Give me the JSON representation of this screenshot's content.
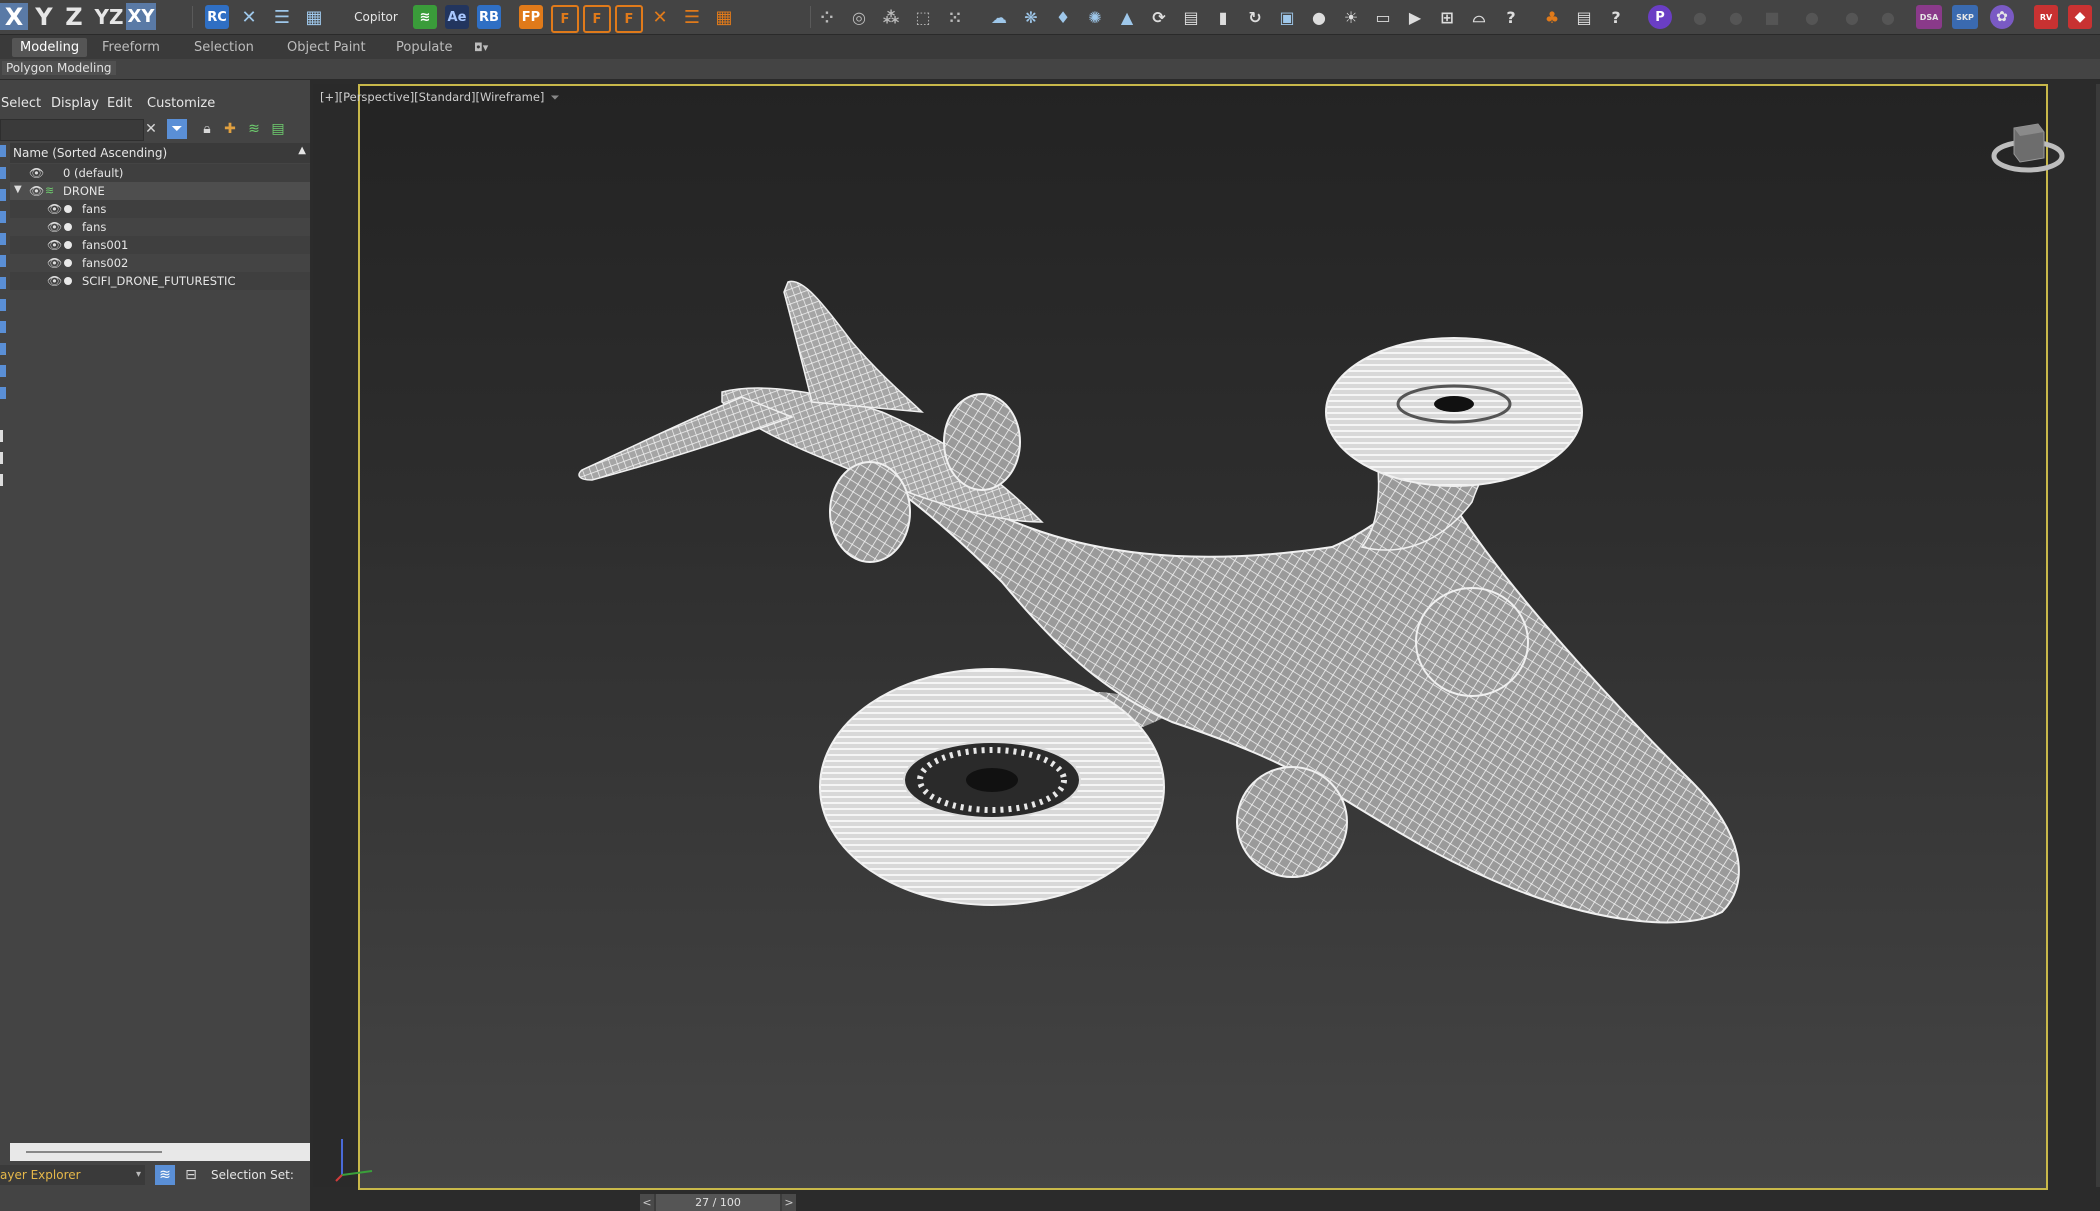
{
  "toolbar": {
    "axis_buttons": [
      "X",
      "Y",
      "Z",
      "YZ",
      "XY"
    ],
    "plugin_labels": [
      "RC",
      "Copitor",
      "Ae",
      "RB",
      "FP",
      "F",
      "F",
      "F"
    ],
    "right_badges": [
      "DSA",
      "SKP",
      "RV"
    ]
  },
  "ribbon": {
    "tabs": [
      "Modeling",
      "Freeform",
      "Selection",
      "Object Paint",
      "Populate"
    ],
    "active_tab": "Modeling",
    "sub_label": "Polygon Modeling"
  },
  "scene_explorer": {
    "menu": [
      "Select",
      "Display",
      "Edit",
      "Customize"
    ],
    "search_placeholder": "",
    "column_header": "Name (Sorted Ascending)",
    "items": [
      {
        "name": "0 (default)",
        "kind": "layer",
        "depth": 0
      },
      {
        "name": "DRONE",
        "kind": "layer",
        "depth": 0,
        "expanded": true
      },
      {
        "name": "fans",
        "kind": "object",
        "depth": 1
      },
      {
        "name": "fans",
        "kind": "object",
        "depth": 1
      },
      {
        "name": "fans001",
        "kind": "object",
        "depth": 1
      },
      {
        "name": "fans002",
        "kind": "object",
        "depth": 1
      },
      {
        "name": "SCIFI_DRONE_FUTURESTIC",
        "kind": "object",
        "depth": 1
      }
    ],
    "explorer_mode": "ayer Explorer",
    "selection_set_label": "Selection Set:"
  },
  "viewport": {
    "label": "[+][Perspective][Standard][Wireframe]",
    "shading": "Wireframe",
    "model_color": "#e8e8e8",
    "border_color": "#c8b84a"
  },
  "timeline": {
    "value": "27 / 100",
    "current_frame": 27,
    "total_frames": 100
  }
}
